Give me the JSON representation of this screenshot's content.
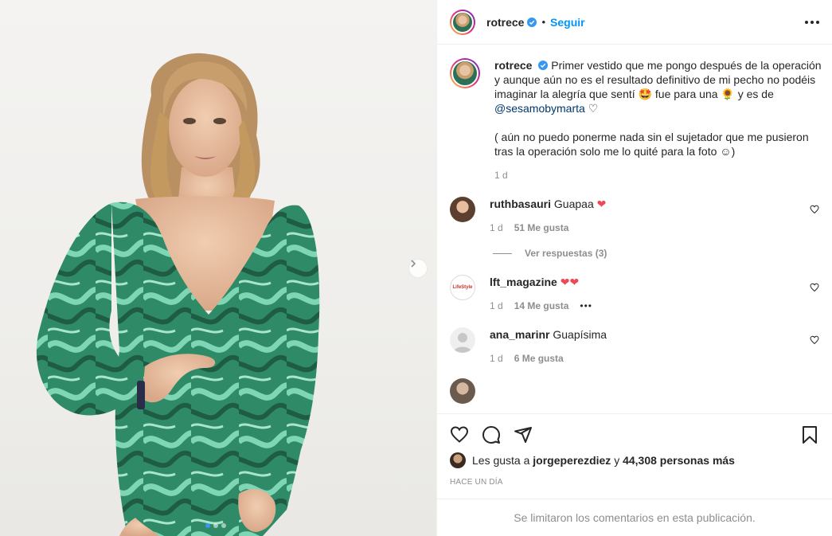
{
  "post": {
    "username": "rotrece",
    "follow_label": "Seguir",
    "separator": "•"
  },
  "caption": {
    "username": "rotrece",
    "text_1": "Primer vestido que me pongo después de la operación y aunque aún no es el resultado definitivo de mi pecho no podéis imaginar la alegría que sentí",
    "text_2": "fue para una",
    "text_3": "y es de",
    "mention": "@sesamobymarta",
    "text_para2": "( aún no puedo ponerme nada sin el sujetador que me pusieron tras la operación solo me lo quité para la foto ☺)",
    "time": "1 d"
  },
  "comments": [
    {
      "username": "ruthbasauri",
      "text": "Guapaa",
      "time": "1 d",
      "likes": "51 Me gusta",
      "view_replies": "Ver respuestas (3)"
    },
    {
      "username": "lft_magazine",
      "text": "",
      "time": "1 d",
      "likes": "14 Me gusta",
      "more": "•••",
      "avatar_text": "LifeStyle"
    },
    {
      "username": "ana_marinr",
      "text": "Guapísima",
      "time": "1 d",
      "likes": "6 Me gusta"
    }
  ],
  "likes": {
    "prefix": "Les gusta a",
    "user": "jorgeperezdiez",
    "middle": "y",
    "count": "44,308 personas más"
  },
  "time_ago": "HACE UN DÍA",
  "comments_limited": "Se limitaron los comentarios en esta publicación.",
  "colors": {
    "link_blue": "#0095f6",
    "mention_blue": "#00376b",
    "muted": "#8e8e8e",
    "heart_red": "#ed4956",
    "dress_green": "#2e7d5e"
  },
  "carousel": {
    "current": 1,
    "total": 3
  }
}
